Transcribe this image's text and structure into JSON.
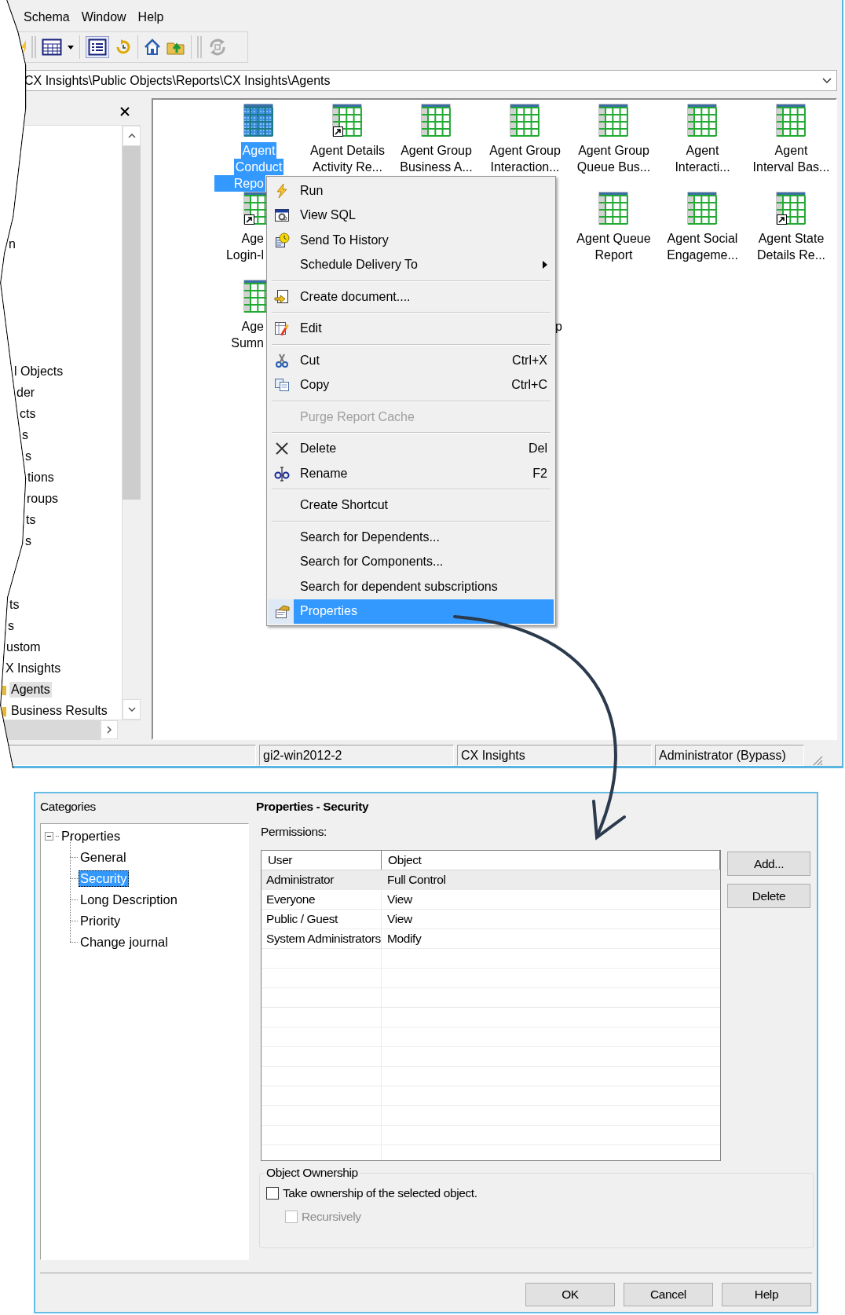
{
  "menu_bar": [
    {
      "label": "Schema"
    },
    {
      "label": "Window"
    },
    {
      "label": "Help"
    }
  ],
  "address": {
    "value": "CX Insights\\Public Objects\\Reports\\CX Insights\\Agents"
  },
  "folder_tree": {
    "items": [
      {
        "label": "n",
        "selected": false
      },
      {
        "label": "l Objects",
        "selected": false
      },
      {
        "label": "der",
        "selected": false
      },
      {
        "label": "cts",
        "selected": false
      },
      {
        "label": "s",
        "selected": false
      },
      {
        "label": "s",
        "selected": false
      },
      {
        "label": "tions",
        "selected": false
      },
      {
        "label": "roups",
        "selected": false
      },
      {
        "label": "ts",
        "selected": false
      },
      {
        "label": "s",
        "selected": false
      },
      {
        "label": "ts",
        "selected": false
      },
      {
        "label": "s",
        "selected": false
      },
      {
        "label": "ustom",
        "selected": false
      },
      {
        "label": "X Insights",
        "selected": false
      },
      {
        "label": "Agents",
        "selected": true
      },
      {
        "label": "Business Results",
        "selected": false
      }
    ]
  },
  "reports": [
    {
      "lines": [
        {
          "text": "Agent",
          "kind": "whole"
        },
        {
          "text": "Conduct",
          "kind": "whole"
        },
        {
          "text": "Repo",
          "kind": "cutright"
        }
      ],
      "selected": true,
      "shortcut": false
    },
    {
      "lines": [
        {
          "text": "Agent Details",
          "kind": "whole"
        },
        {
          "text": "Activity Re...",
          "kind": "whole"
        }
      ],
      "selected": false,
      "shortcut": true
    },
    {
      "lines": [
        {
          "text": "Agent Group",
          "kind": "whole"
        },
        {
          "text": "Business A...",
          "kind": "whole"
        }
      ],
      "selected": false,
      "shortcut": false
    },
    {
      "lines": [
        {
          "text": "Agent Group",
          "kind": "whole"
        },
        {
          "text": "Interaction...",
          "kind": "whole"
        }
      ],
      "selected": false,
      "shortcut": false
    },
    {
      "lines": [
        {
          "text": "Agent Group",
          "kind": "whole"
        },
        {
          "text": "Queue Bus...",
          "kind": "whole"
        }
      ],
      "selected": false,
      "shortcut": false
    },
    {
      "lines": [
        {
          "text": "Agent",
          "kind": "whole"
        },
        {
          "text": "Interacti...",
          "kind": "whole"
        }
      ],
      "selected": false,
      "shortcut": false
    },
    {
      "lines": [
        {
          "text": "Agent",
          "kind": "whole"
        },
        {
          "text": "Interval Bas...",
          "kind": "whole"
        }
      ],
      "selected": false,
      "shortcut": false
    },
    {
      "lines": [
        {
          "text": "Age",
          "kind": "cutright"
        },
        {
          "text": "Login-l",
          "kind": "cutright"
        }
      ],
      "selected": false,
      "shortcut": true
    },
    {
      "lines": [
        {
          "text": "Agent Queue",
          "kind": "whole"
        },
        {
          "text": "Report",
          "kind": "whole"
        }
      ],
      "selected": false,
      "shortcut": false
    },
    {
      "lines": [
        {
          "text": "Agent Social",
          "kind": "whole"
        },
        {
          "text": "Engageme...",
          "kind": "whole"
        }
      ],
      "selected": false,
      "shortcut": false
    },
    {
      "lines": [
        {
          "text": "Agent State",
          "kind": "whole"
        },
        {
          "text": "Details Re...",
          "kind": "whole"
        }
      ],
      "selected": false,
      "shortcut": true
    },
    {
      "lines": [
        {
          "text": "Age",
          "kind": "cutright"
        },
        {
          "text": "Sumn",
          "kind": "cutright"
        }
      ],
      "selected": false,
      "shortcut": false
    },
    {
      "lines": [
        {
          "text": "p",
          "kind": "cutleft"
        }
      ],
      "selected": false
    }
  ],
  "context_menu": {
    "items": [
      {
        "kind": "item",
        "label": "Run",
        "submenu": false,
        "disabled": false,
        "selected": false
      },
      {
        "kind": "item",
        "label": "View SQL",
        "submenu": false,
        "disabled": false,
        "selected": false
      },
      {
        "kind": "item",
        "label": "Send To History",
        "submenu": false,
        "disabled": false,
        "selected": false
      },
      {
        "kind": "item",
        "label": "Schedule Delivery To",
        "submenu": true,
        "disabled": false,
        "selected": false
      },
      {
        "kind": "separator"
      },
      {
        "kind": "item",
        "label": "Create document....",
        "submenu": false,
        "disabled": false,
        "selected": false
      },
      {
        "kind": "separator"
      },
      {
        "kind": "item",
        "label": "Edit",
        "submenu": false,
        "disabled": false,
        "selected": false
      },
      {
        "kind": "separator"
      },
      {
        "kind": "item",
        "label": "Cut",
        "shortcut": "Ctrl+X",
        "submenu": false,
        "disabled": false,
        "selected": false
      },
      {
        "kind": "item",
        "label": "Copy",
        "shortcut": "Ctrl+C",
        "submenu": false,
        "disabled": false,
        "selected": false
      },
      {
        "kind": "separator"
      },
      {
        "kind": "item",
        "label": "Purge Report Cache",
        "submenu": false,
        "disabled": true,
        "selected": false
      },
      {
        "kind": "separator"
      },
      {
        "kind": "item",
        "label": "Delete",
        "shortcut": "Del",
        "submenu": false,
        "disabled": false,
        "selected": false
      },
      {
        "kind": "item",
        "label": "Rename",
        "shortcut": "F2",
        "submenu": false,
        "disabled": false,
        "selected": false
      },
      {
        "kind": "separator"
      },
      {
        "kind": "item",
        "label": "Create Shortcut",
        "submenu": false,
        "disabled": false,
        "selected": false
      },
      {
        "kind": "separator"
      },
      {
        "kind": "item",
        "label": "Search for Dependents...",
        "submenu": false,
        "disabled": false,
        "selected": false
      },
      {
        "kind": "item",
        "label": "Search for Components...",
        "submenu": false,
        "disabled": false,
        "selected": false
      },
      {
        "kind": "item",
        "label": "Search for dependent subscriptions",
        "submenu": false,
        "disabled": false,
        "selected": false
      },
      {
        "kind": "item",
        "label": "Properties",
        "submenu": false,
        "disabled": false,
        "selected": true
      }
    ]
  },
  "status_bar": [
    "gi2-win2012-2",
    "CX Insights",
    "Administrator (Bypass)"
  ],
  "dialog": {
    "categories_label": "Categories",
    "categories": [
      {
        "label": "Properties",
        "expanded": true,
        "selected": false,
        "children": [
          {
            "label": "General",
            "selected": false
          },
          {
            "label": "Security",
            "selected": true
          },
          {
            "label": "Long Description",
            "selected": false
          },
          {
            "label": "Priority",
            "selected": false
          },
          {
            "label": "Change journal",
            "selected": false
          }
        ]
      }
    ],
    "title": "Properties - Security",
    "permissions_label": {
      "label": "Permissions:"
    },
    "table": {
      "columns": [
        "User",
        "Object"
      ],
      "rows": [
        {
          "cells": [
            "Administrator",
            "Full Control"
          ],
          "selected": true
        },
        {
          "cells": [
            "Everyone",
            "View"
          ],
          "selected": false
        },
        {
          "cells": [
            "Public / Guest",
            "View"
          ],
          "selected": false
        },
        {
          "cells": [
            "System Administrators",
            "Modify"
          ],
          "selected": false
        }
      ]
    },
    "side_buttons": [
      "Add...",
      "Delete"
    ],
    "ownership": {
      "title": "Object Ownership",
      "options": [
        {
          "label": "Take ownership of the selected object.",
          "checked": false,
          "disabled": false
        },
        {
          "label": "Recursively",
          "checked": false,
          "disabled": true
        }
      ]
    },
    "buttons": [
      {
        "label": "OK"
      },
      {
        "label": "Cancel"
      },
      {
        "label": "Help"
      }
    ]
  }
}
